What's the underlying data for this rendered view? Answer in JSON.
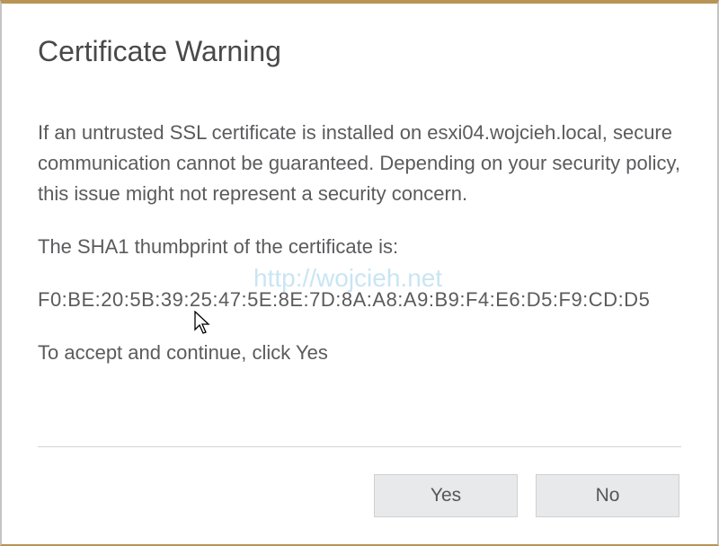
{
  "dialog": {
    "title": "Certificate Warning",
    "warning_text": "If an untrusted SSL certificate is installed on esxi04.wojcieh.local, secure communication cannot be guaranteed. Depending on your security policy, this issue might not represent a security concern.",
    "thumbprint_label": "The SHA1 thumbprint of the certificate is:",
    "thumbprint_value": "F0:BE:20:5B:39:25:47:5E:8E:7D:8A:A8:A9:B9:F4:E6:D5:F9:CD:D5",
    "accept_text": "To accept and continue, click Yes",
    "watermark": "http://wojcieh.net",
    "buttons": {
      "yes": "Yes",
      "no": "No"
    }
  }
}
